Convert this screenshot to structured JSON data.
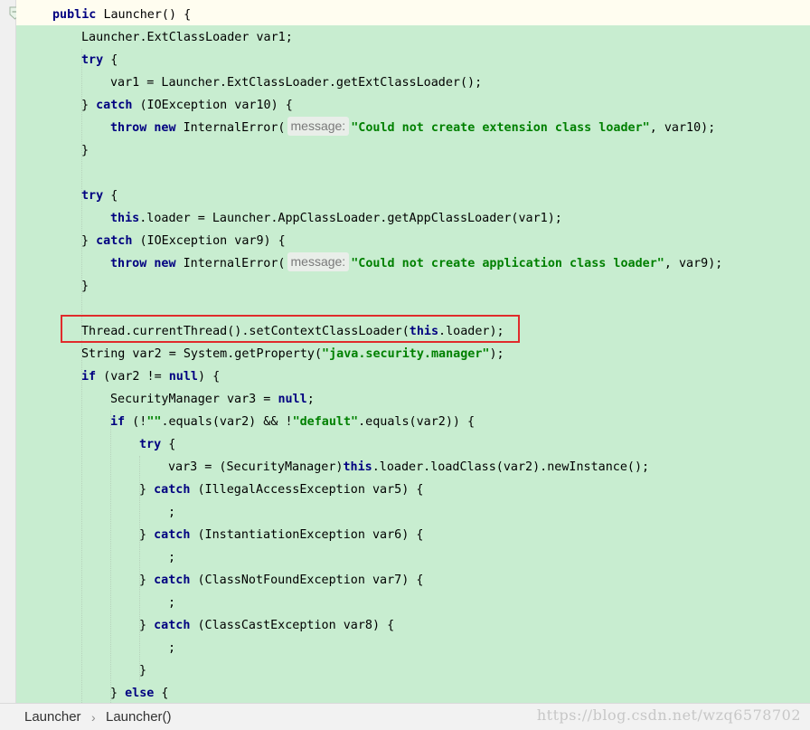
{
  "status_bar": {
    "breadcrumb_class": "Launcher",
    "breadcrumb_separator": "›",
    "breadcrumb_method": "Launcher()",
    "watermark": "https://blog.csdn.net/wzq6578702"
  },
  "code_lines": [
    {
      "indent": 1,
      "tokens": [
        {
          "t": "kw",
          "v": "public "
        },
        {
          "t": "plain",
          "v": "Launcher() {"
        }
      ]
    },
    {
      "indent": 2,
      "tokens": [
        {
          "t": "plain",
          "v": "Launcher.ExtClassLoader var1;"
        }
      ]
    },
    {
      "indent": 2,
      "tokens": [
        {
          "t": "kw",
          "v": "try"
        },
        {
          "t": "plain",
          "v": " {"
        }
      ]
    },
    {
      "indent": 3,
      "tokens": [
        {
          "t": "plain",
          "v": "var1 = Launcher.ExtClassLoader.getExtClassLoader();"
        }
      ]
    },
    {
      "indent": 2,
      "tokens": [
        {
          "t": "plain",
          "v": "} "
        },
        {
          "t": "kw",
          "v": "catch"
        },
        {
          "t": "plain",
          "v": " (IOException var10) {"
        }
      ]
    },
    {
      "indent": 3,
      "tokens": [
        {
          "t": "kw",
          "v": "throw new "
        },
        {
          "t": "plain",
          "v": "InternalError("
        },
        {
          "t": "hint",
          "v": "message:"
        },
        {
          "t": "str",
          "v": "\"Could not create extension class loader\""
        },
        {
          "t": "plain",
          "v": ", var10);"
        }
      ]
    },
    {
      "indent": 2,
      "tokens": [
        {
          "t": "plain",
          "v": "}"
        }
      ]
    },
    {
      "indent": 2,
      "tokens": []
    },
    {
      "indent": 2,
      "tokens": [
        {
          "t": "kw",
          "v": "try"
        },
        {
          "t": "plain",
          "v": " {"
        }
      ]
    },
    {
      "indent": 3,
      "tokens": [
        {
          "t": "kw",
          "v": "this"
        },
        {
          "t": "plain",
          "v": ".loader = Launcher.AppClassLoader.getAppClassLoader(var1);"
        }
      ]
    },
    {
      "indent": 2,
      "tokens": [
        {
          "t": "plain",
          "v": "} "
        },
        {
          "t": "kw",
          "v": "catch"
        },
        {
          "t": "plain",
          "v": " (IOException var9) {"
        }
      ]
    },
    {
      "indent": 3,
      "tokens": [
        {
          "t": "kw",
          "v": "throw new "
        },
        {
          "t": "plain",
          "v": "InternalError("
        },
        {
          "t": "hint",
          "v": "message:"
        },
        {
          "t": "str",
          "v": "\"Could not create application class loader\""
        },
        {
          "t": "plain",
          "v": ", var9);"
        }
      ]
    },
    {
      "indent": 2,
      "tokens": [
        {
          "t": "plain",
          "v": "}"
        }
      ]
    },
    {
      "indent": 2,
      "tokens": []
    },
    {
      "indent": 2,
      "tokens": [
        {
          "t": "plain",
          "v": "Thread.currentThread().setContextClassLoader("
        },
        {
          "t": "kw",
          "v": "this"
        },
        {
          "t": "plain",
          "v": ".loader);"
        }
      ]
    },
    {
      "indent": 2,
      "tokens": [
        {
          "t": "plain",
          "v": "String var2 = System.getProperty("
        },
        {
          "t": "str",
          "v": "\"java.security.manager\""
        },
        {
          "t": "plain",
          "v": ");"
        }
      ]
    },
    {
      "indent": 2,
      "tokens": [
        {
          "t": "kw",
          "v": "if"
        },
        {
          "t": "plain",
          "v": " (var2 != "
        },
        {
          "t": "kw",
          "v": "null"
        },
        {
          "t": "plain",
          "v": ") {"
        }
      ]
    },
    {
      "indent": 3,
      "tokens": [
        {
          "t": "plain",
          "v": "SecurityManager var3 = "
        },
        {
          "t": "kw",
          "v": "null"
        },
        {
          "t": "plain",
          "v": ";"
        }
      ]
    },
    {
      "indent": 3,
      "tokens": [
        {
          "t": "kw",
          "v": "if"
        },
        {
          "t": "plain",
          "v": " (!"
        },
        {
          "t": "str",
          "v": "\"\""
        },
        {
          "t": "plain",
          "v": ".equals(var2) && !"
        },
        {
          "t": "str",
          "v": "\"default\""
        },
        {
          "t": "plain",
          "v": ".equals(var2)) {"
        }
      ]
    },
    {
      "indent": 4,
      "tokens": [
        {
          "t": "kw",
          "v": "try"
        },
        {
          "t": "plain",
          "v": " {"
        }
      ]
    },
    {
      "indent": 5,
      "tokens": [
        {
          "t": "plain",
          "v": "var3 = (SecurityManager)"
        },
        {
          "t": "kw",
          "v": "this"
        },
        {
          "t": "plain",
          "v": ".loader.loadClass(var2).newInstance();"
        }
      ]
    },
    {
      "indent": 4,
      "tokens": [
        {
          "t": "plain",
          "v": "} "
        },
        {
          "t": "kw",
          "v": "catch"
        },
        {
          "t": "plain",
          "v": " (IllegalAccessException var5) {"
        }
      ]
    },
    {
      "indent": 5,
      "tokens": [
        {
          "t": "plain",
          "v": ";"
        }
      ]
    },
    {
      "indent": 4,
      "tokens": [
        {
          "t": "plain",
          "v": "} "
        },
        {
          "t": "kw",
          "v": "catch"
        },
        {
          "t": "plain",
          "v": " (InstantiationException var6) {"
        }
      ]
    },
    {
      "indent": 5,
      "tokens": [
        {
          "t": "plain",
          "v": ";"
        }
      ]
    },
    {
      "indent": 4,
      "tokens": [
        {
          "t": "plain",
          "v": "} "
        },
        {
          "t": "kw",
          "v": "catch"
        },
        {
          "t": "plain",
          "v": " (ClassNotFoundException var7) {"
        }
      ]
    },
    {
      "indent": 5,
      "tokens": [
        {
          "t": "plain",
          "v": ";"
        }
      ]
    },
    {
      "indent": 4,
      "tokens": [
        {
          "t": "plain",
          "v": "} "
        },
        {
          "t": "kw",
          "v": "catch"
        },
        {
          "t": "plain",
          "v": " (ClassCastException var8) {"
        }
      ]
    },
    {
      "indent": 5,
      "tokens": [
        {
          "t": "plain",
          "v": ";"
        }
      ]
    },
    {
      "indent": 4,
      "tokens": [
        {
          "t": "plain",
          "v": "}"
        }
      ]
    },
    {
      "indent": 3,
      "tokens": [
        {
          "t": "plain",
          "v": "} "
        },
        {
          "t": "kw",
          "v": "else"
        },
        {
          "t": "plain",
          "v": " {"
        }
      ]
    }
  ]
}
